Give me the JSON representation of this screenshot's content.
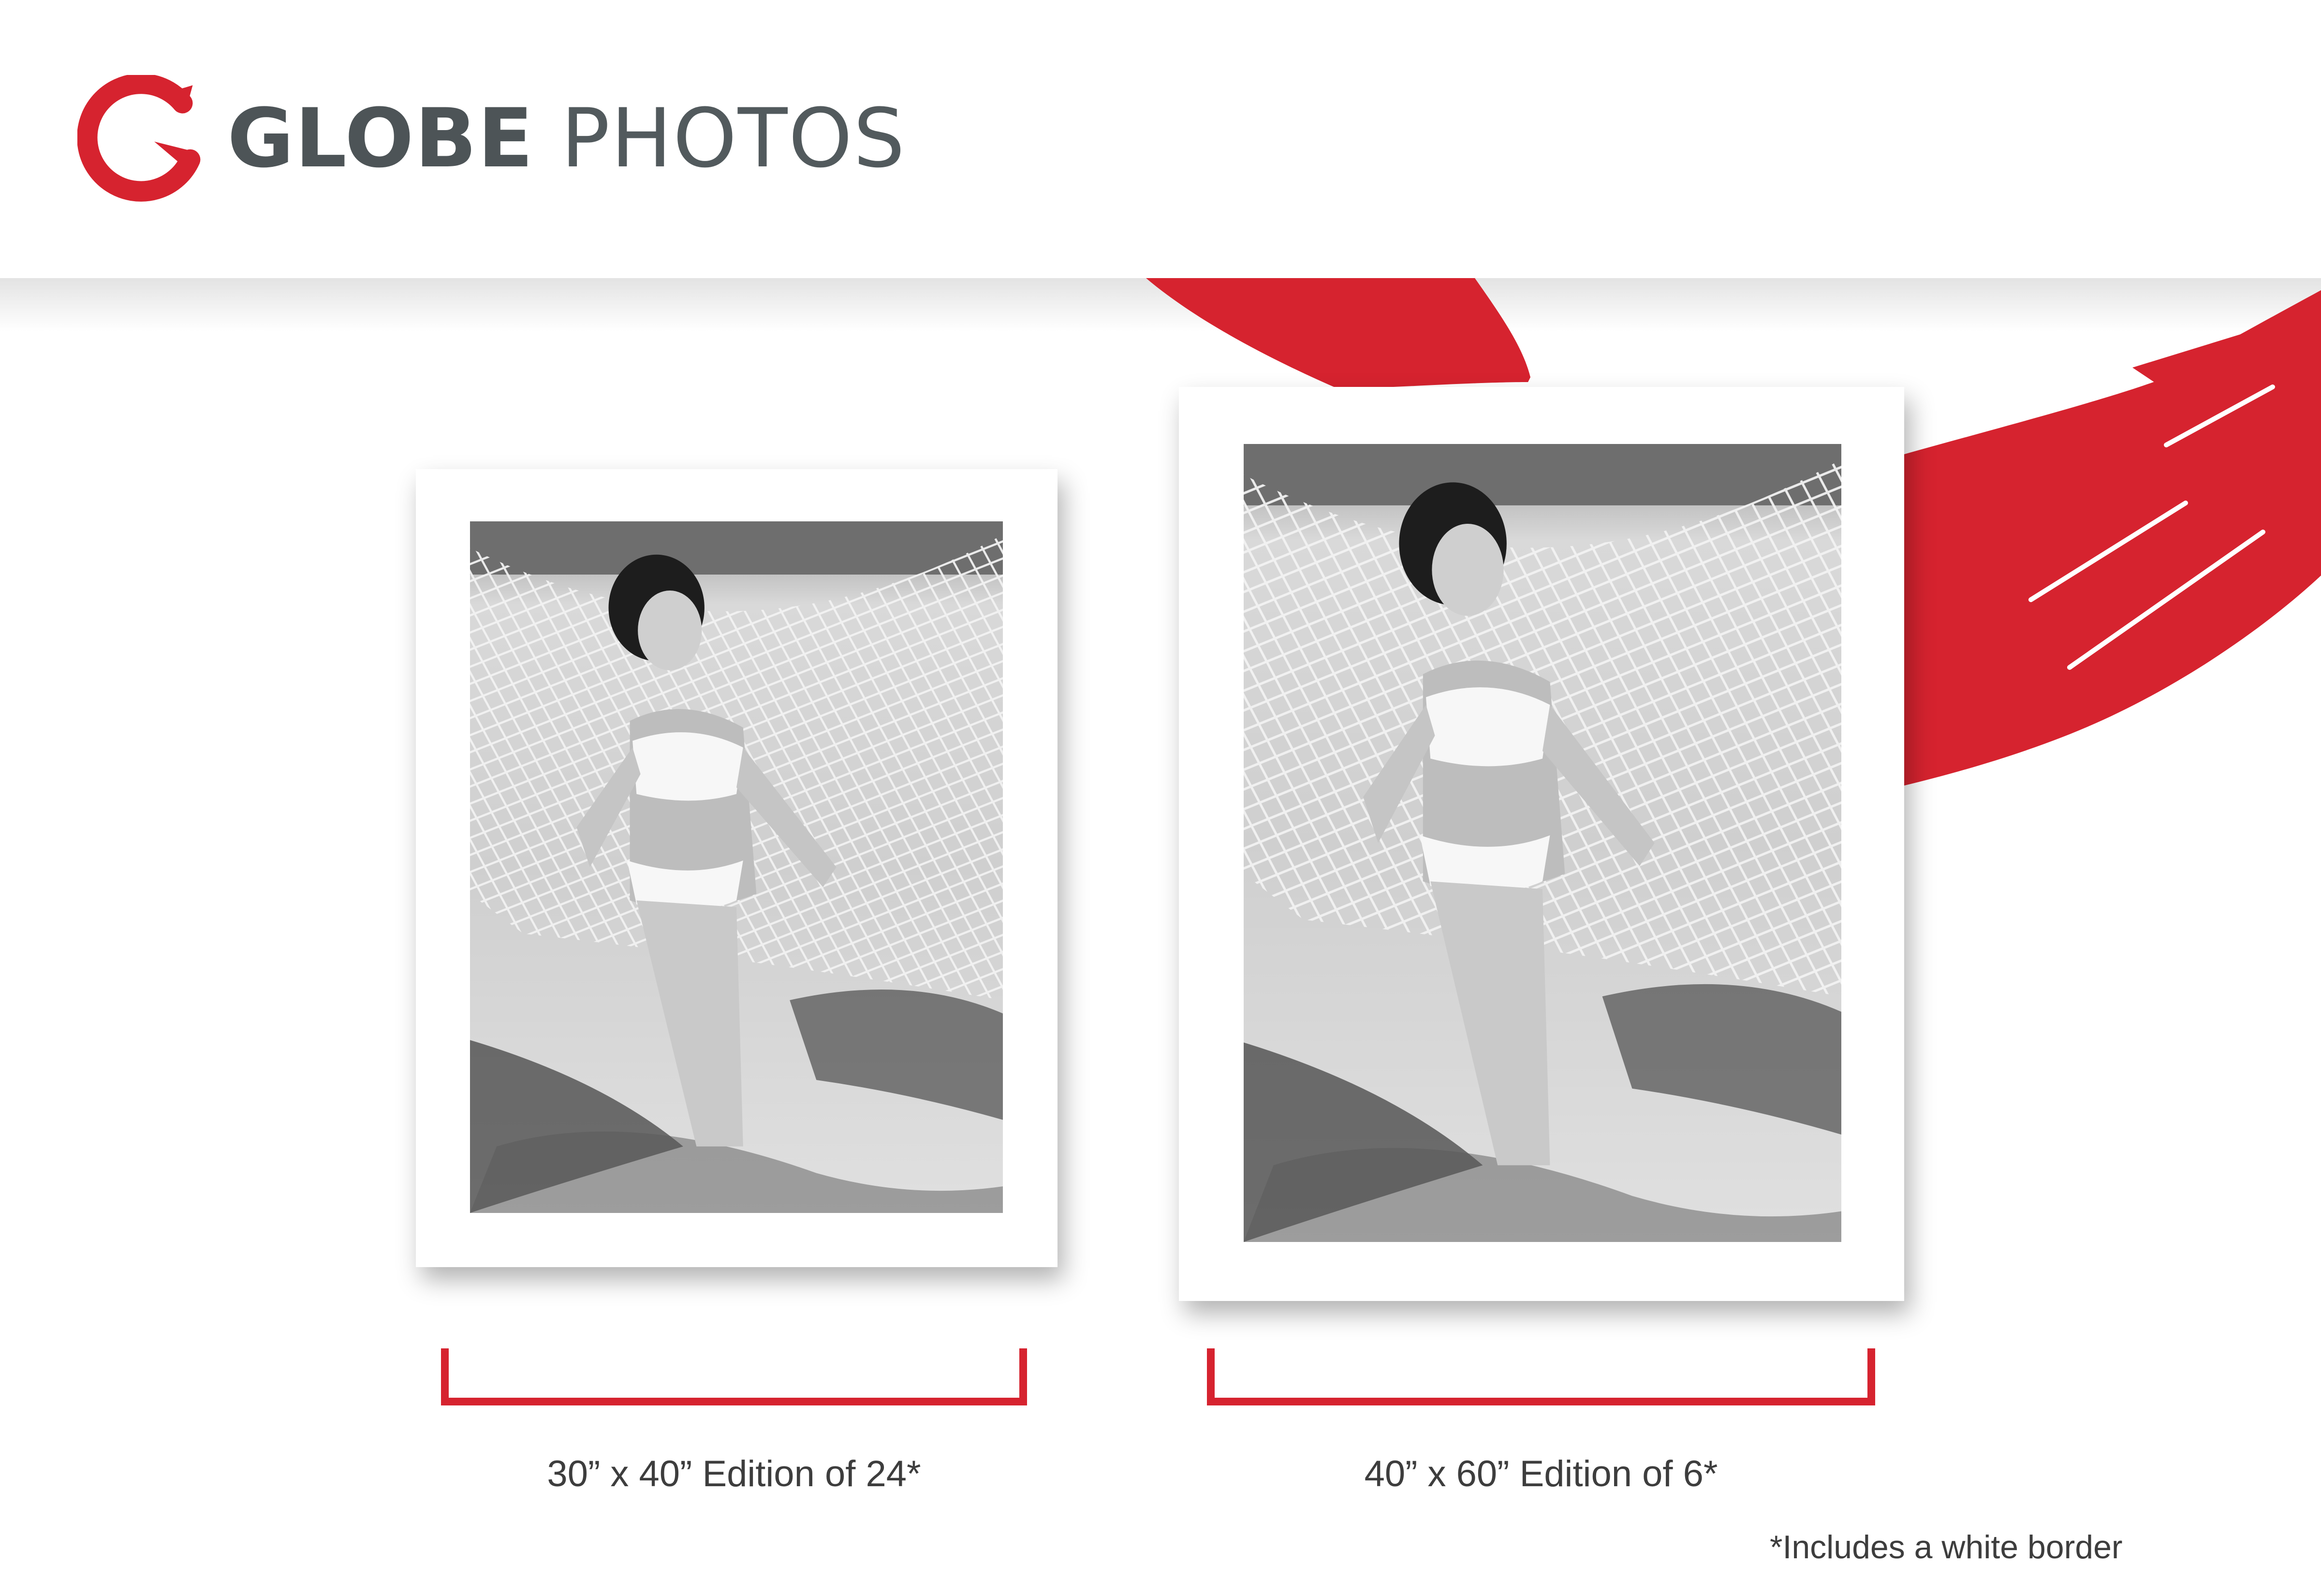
{
  "brand": {
    "name_bold": "GLOBE",
    "name_light": "PHOTOS",
    "accent_color": "#d6232f",
    "text_color": "#4d5457"
  },
  "prints": [
    {
      "size_caption": "30” x 40” Edition of 24*"
    },
    {
      "size_caption": "40” x 60” Edition of 6*"
    }
  ],
  "photo": {
    "style": "black-and-white",
    "subject": "woman-in-white-bikini-on-hammock-icon"
  },
  "footnote": "*Includes a white border"
}
